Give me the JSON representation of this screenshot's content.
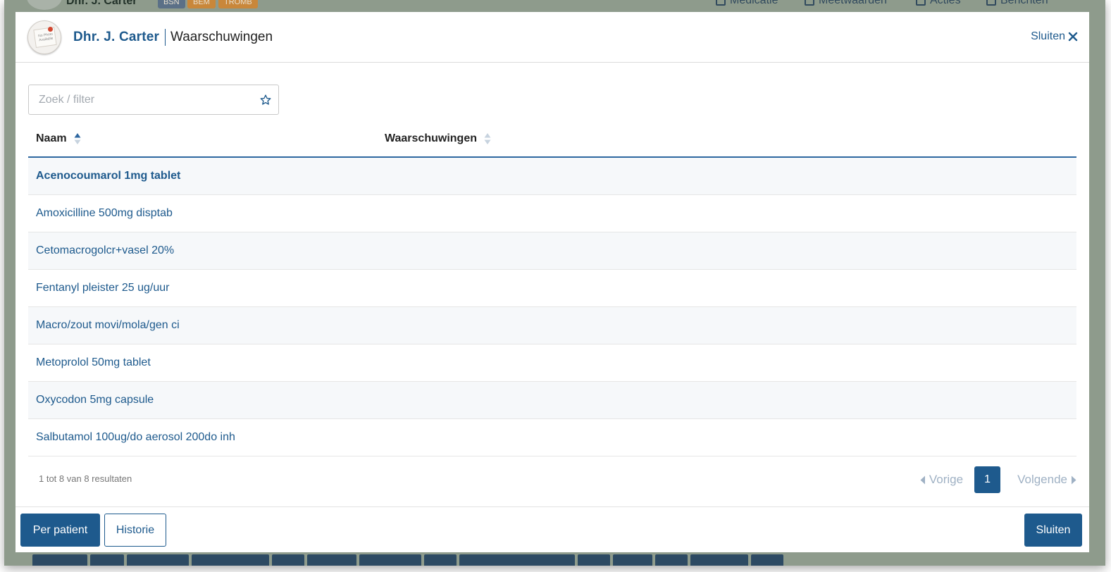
{
  "background": {
    "patient_name": "Dhr. J. Carter",
    "badges": [
      {
        "label": "BSN",
        "color": "#5b7087"
      },
      {
        "label": "BEM",
        "color": "#c9873a"
      },
      {
        "label": "TROMB",
        "color": "#c9873a"
      }
    ],
    "nav": [
      "Medicatie",
      "Meetwaarden",
      "Acties",
      "Berichten"
    ]
  },
  "header": {
    "avatar_text": "No Photo Available",
    "patient_name": "Dhr. J. Carter",
    "title": "Waarschuwingen",
    "close_label": "Sluiten"
  },
  "search": {
    "placeholder": "Zoek / filter",
    "value": ""
  },
  "table": {
    "columns": [
      {
        "label": "Naam",
        "sort": "ascending"
      },
      {
        "label": "Waarschuwingen",
        "sort": "none"
      }
    ],
    "rows": [
      {
        "naam": "Acenocoumarol 1mg tablet",
        "waarschuwingen": ""
      },
      {
        "naam": "Amoxicilline 500mg disptab",
        "waarschuwingen": ""
      },
      {
        "naam": "Cetomacrogolcr+vasel 20%",
        "waarschuwingen": ""
      },
      {
        "naam": "Fentanyl pleister 25 ug/uur",
        "waarschuwingen": ""
      },
      {
        "naam": "Macro/zout movi/mola/gen ci",
        "waarschuwingen": ""
      },
      {
        "naam": "Metoprolol 50mg tablet",
        "waarschuwingen": ""
      },
      {
        "naam": "Oxycodon 5mg capsule",
        "waarschuwingen": ""
      },
      {
        "naam": "Salbutamol 100ug/do aerosol 200do inh",
        "waarschuwingen": ""
      }
    ]
  },
  "pagination": {
    "summary": "1 tot 8 van 8 resultaten",
    "prev_label": "Vorige",
    "current_page": "1",
    "next_label": "Volgende"
  },
  "footer": {
    "per_patient_label": "Per patient",
    "historie_label": "Historie",
    "close_label": "Sluiten"
  },
  "colors": {
    "primary": "#1e5a8d",
    "overlay": "#8e9b8c",
    "row_stripe": "#f6f8fa"
  }
}
